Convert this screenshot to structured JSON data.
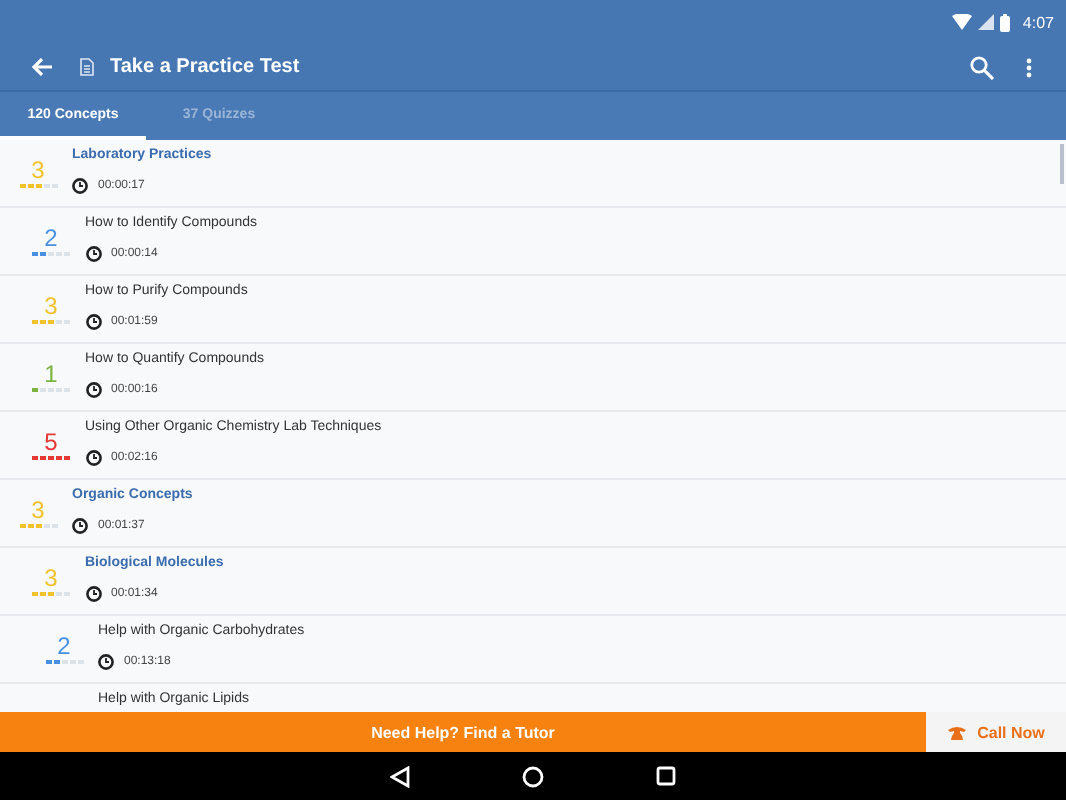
{
  "status_bar": {
    "time": "4:07"
  },
  "toolbar": {
    "title": "Take a Practice Test"
  },
  "tabs": [
    {
      "label": "120 Concepts",
      "selected": true
    },
    {
      "label": "37 Quizzes",
      "selected": false
    }
  ],
  "outline": [
    {
      "kind": "chapter",
      "title": "Laboratory Practices",
      "rating": "3",
      "stars": 3,
      "time": "00:00:17",
      "children": [
        {
          "kind": "lesson",
          "title": "How to Identify Compounds",
          "rating": "2",
          "stars": 2,
          "time": "00:00:14"
        },
        {
          "kind": "lesson",
          "title": "How to Purify Compounds",
          "rating": "3",
          "stars": 3,
          "time": "00:01:59"
        },
        {
          "kind": "lesson",
          "title": "How to Quantify Compounds",
          "rating": "1",
          "stars": 1,
          "time": "00:00:16"
        },
        {
          "kind": "lesson",
          "title": "Using Other Organic Chemistry Lab Techniques",
          "rating": "5",
          "stars": 5,
          "time": "00:02:16"
        }
      ]
    },
    {
      "kind": "chapter",
      "title": "Organic Concepts",
      "rating": "3",
      "stars": 3,
      "time": "00:01:37",
      "children": [
        {
          "kind": "chapter",
          "title": "Biological Molecules",
          "rating": "3",
          "stars": 3,
          "time": "00:01:34",
          "children": [
            {
              "kind": "lesson",
              "title": "Help with Organic Carbohydrates",
              "rating": "2",
              "stars": 2,
              "time": "00:13:18"
            },
            {
              "kind": "lesson",
              "title": "Help with Organic Lipids"
            }
          ]
        }
      ]
    }
  ],
  "banner": {
    "text": "Need Help? Find a Tutor",
    "call": "Call Now"
  }
}
